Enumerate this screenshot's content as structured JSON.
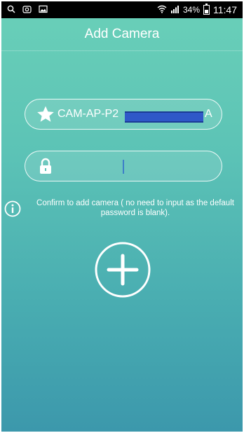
{
  "status_bar": {
    "icons": [
      "search-icon",
      "camera-icon",
      "image-icon",
      "wifi-icon",
      "signal-icon",
      "battery-icon"
    ],
    "battery": "34%",
    "time": "11:47"
  },
  "header": {
    "title": "Add Camera"
  },
  "form": {
    "ssid": {
      "icon": "star-icon",
      "value_prefix": "CAM-AP-P2",
      "value_suffix": "A"
    },
    "password": {
      "icon": "lock-icon",
      "value": ""
    },
    "hint": {
      "icon": "info-icon",
      "text": "Confirm to add camera ( no need to input as the default password is blank)."
    }
  },
  "add_button": {
    "icon": "plus-icon"
  },
  "colors": {
    "gradient_top": "#6ad0b8",
    "gradient_bottom": "#3c98ac",
    "text": "#ffffff"
  }
}
